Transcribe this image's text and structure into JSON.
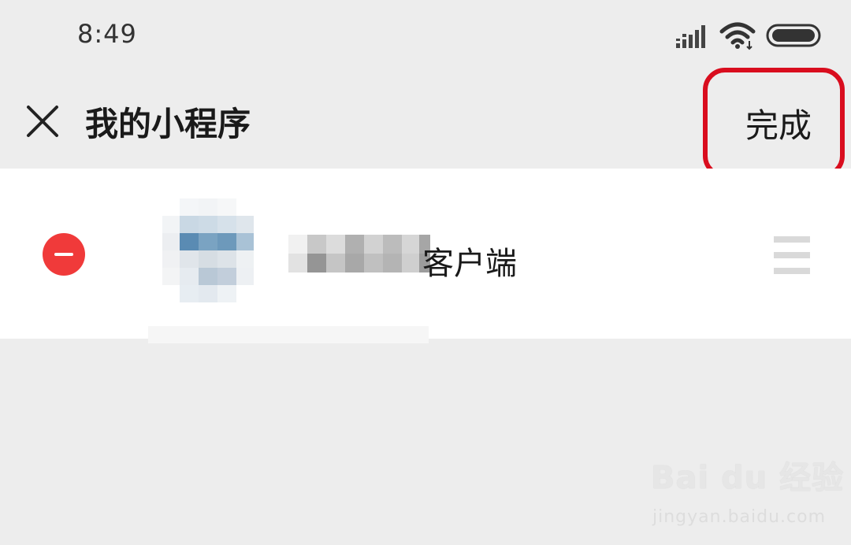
{
  "status_bar": {
    "time": "8:49",
    "icons": [
      "signal-icon",
      "wifi-icon",
      "battery-icon"
    ]
  },
  "header": {
    "title": "我的小程序",
    "close_icon": "close-icon",
    "done_label": "完成",
    "highlight_color": "#d90d1e"
  },
  "mini_programs": [
    {
      "name_visible": "客户端",
      "name_obscured": true,
      "remove_icon": "minus-circle-icon",
      "drag_icon": "drag-handle-icon"
    }
  ],
  "watermark": {
    "main": "Bai du 经验",
    "sub": "jingyan.baidu.com"
  },
  "colors": {
    "background": "#ededed",
    "list_background": "#ffffff",
    "remove": "#f03a3a",
    "drag_handle": "#d9d9d9"
  }
}
